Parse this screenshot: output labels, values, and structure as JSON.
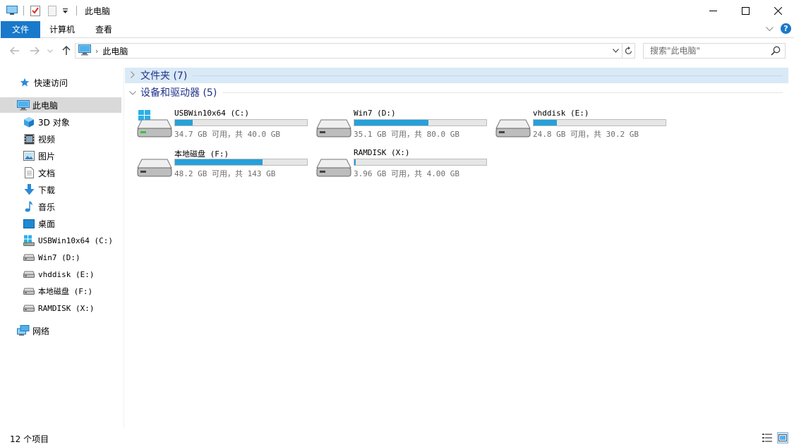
{
  "window": {
    "title": "此电脑"
  },
  "ribbon": {
    "tabs": [
      {
        "label": "文件"
      },
      {
        "label": "计算机"
      },
      {
        "label": "查看"
      }
    ],
    "help_label": "?"
  },
  "address": {
    "crumb": "此电脑",
    "separator": "›"
  },
  "search": {
    "placeholder": "搜索\"此电脑\""
  },
  "sidebar": {
    "items": [
      {
        "label": "快速访问",
        "icon": "star-icon"
      },
      {
        "label": "此电脑",
        "icon": "computer-icon",
        "selected": true
      },
      {
        "label": "3D 对象",
        "icon": "cube-icon"
      },
      {
        "label": "视频",
        "icon": "video-icon"
      },
      {
        "label": "图片",
        "icon": "picture-icon"
      },
      {
        "label": "文档",
        "icon": "document-icon"
      },
      {
        "label": "下载",
        "icon": "download-icon"
      },
      {
        "label": "音乐",
        "icon": "music-icon"
      },
      {
        "label": "桌面",
        "icon": "desktop-icon"
      },
      {
        "label": "USBWin10x64 (C:)",
        "icon": "windows-drive-icon"
      },
      {
        "label": "Win7 (D:)",
        "icon": "drive-icon"
      },
      {
        "label": "vhddisk (E:)",
        "icon": "drive-icon"
      },
      {
        "label": "本地磁盘 (F:)",
        "icon": "drive-icon"
      },
      {
        "label": "RAMDISK (X:)",
        "icon": "drive-icon"
      },
      {
        "label": "网络",
        "icon": "network-icon"
      }
    ]
  },
  "groups": {
    "folders": {
      "title": "文件夹 (7)",
      "collapsed": true
    },
    "devices": {
      "title": "设备和驱动器 (5)",
      "collapsed": false
    }
  },
  "drives": [
    {
      "name": "USBWin10x64 (C:)",
      "free": "34.7 GB 可用，共 40.0 GB",
      "used_fraction": 0.1325,
      "icon": "windows-drive-icon"
    },
    {
      "name": "Win7 (D:)",
      "free": "35.1 GB 可用，共 80.0 GB",
      "used_fraction": 0.56125,
      "icon": "drive-icon"
    },
    {
      "name": "vhddisk (E:)",
      "free": "24.8 GB 可用，共 30.2 GB",
      "used_fraction": 0.1788,
      "icon": "drive-icon"
    },
    {
      "name": "本地磁盘 (F:)",
      "free": "48.2 GB 可用，共 143 GB",
      "used_fraction": 0.663,
      "icon": "drive-icon"
    },
    {
      "name": "RAMDISK (X:)",
      "free": "3.96 GB 可用，共 4.00 GB",
      "used_fraction": 0.01,
      "icon": "drive-icon"
    }
  ],
  "status": {
    "count": "12 个项目"
  },
  "colors": {
    "accent": "#1979ca",
    "bar_fill": "#26a0da",
    "selection": "#d9d9d9",
    "group_highlight": "#d9e9f6"
  }
}
